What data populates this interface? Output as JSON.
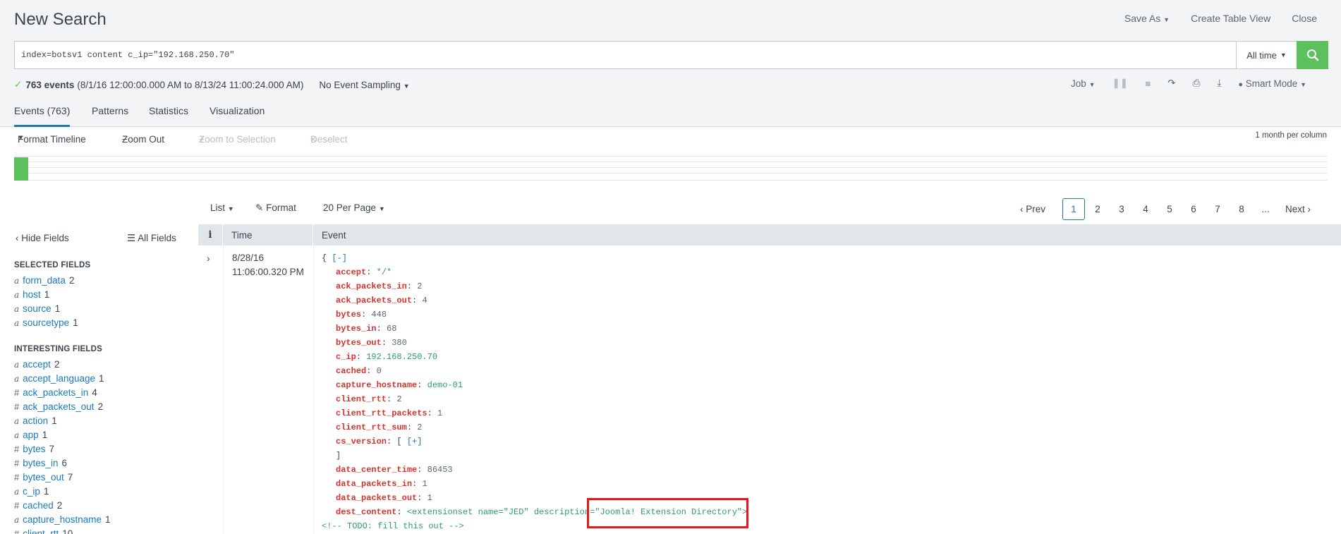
{
  "header": {
    "title": "New Search",
    "actions": [
      "Save As",
      "Create Table View",
      "Close"
    ]
  },
  "search": {
    "query": "index=botsv1 content c_ip=\"192.168.250.70\"",
    "time_range": "All time"
  },
  "status": {
    "count": "763 events",
    "range": "(8/1/16 12:00:00.000 AM to 8/13/24 11:00:24.000 AM)",
    "sampling": "No Event Sampling",
    "job": "Job",
    "mode": "Smart Mode"
  },
  "tabs": [
    "Events (763)",
    "Patterns",
    "Statistics",
    "Visualization"
  ],
  "timeline": {
    "format": "Format Timeline",
    "zoom_out": "Zoom Out",
    "zoom_selection": "Zoom to Selection",
    "deselect": "Deselect",
    "per_column": "1 month per column"
  },
  "list_controls": {
    "list": "List",
    "format": "Format",
    "per_page": "20 Per Page"
  },
  "pager": {
    "prev": "Prev",
    "pages": [
      "1",
      "2",
      "3",
      "4",
      "5",
      "6",
      "7",
      "8"
    ],
    "ellipsis": "...",
    "next": "Next",
    "current": "1"
  },
  "sidebar": {
    "hide_fields": "Hide Fields",
    "all_fields": "All Fields",
    "selected_heading": "SELECTED FIELDS",
    "selected": [
      {
        "type": "a",
        "name": "form_data",
        "count": "2"
      },
      {
        "type": "a",
        "name": "host",
        "count": "1"
      },
      {
        "type": "a",
        "name": "source",
        "count": "1"
      },
      {
        "type": "a",
        "name": "sourcetype",
        "count": "1"
      }
    ],
    "interesting_heading": "INTERESTING FIELDS",
    "interesting": [
      {
        "type": "a",
        "name": "accept",
        "count": "2"
      },
      {
        "type": "a",
        "name": "accept_language",
        "count": "1"
      },
      {
        "type": "#",
        "name": "ack_packets_in",
        "count": "4"
      },
      {
        "type": "#",
        "name": "ack_packets_out",
        "count": "2"
      },
      {
        "type": "a",
        "name": "action",
        "count": "1"
      },
      {
        "type": "a",
        "name": "app",
        "count": "1"
      },
      {
        "type": "#",
        "name": "bytes",
        "count": "7"
      },
      {
        "type": "#",
        "name": "bytes_in",
        "count": "6"
      },
      {
        "type": "#",
        "name": "bytes_out",
        "count": "7"
      },
      {
        "type": "a",
        "name": "c_ip",
        "count": "1"
      },
      {
        "type": "#",
        "name": "cached",
        "count": "2"
      },
      {
        "type": "a",
        "name": "capture_hostname",
        "count": "1"
      },
      {
        "type": "#",
        "name": "client_rtt",
        "count": "10"
      }
    ]
  },
  "table": {
    "col_info": "i",
    "col_time": "Time",
    "col_event": "Event"
  },
  "event": {
    "date": "8/28/16",
    "time": "11:06:00.320 PM",
    "open_brace": "{",
    "collapse": "[-]",
    "fields": [
      {
        "key": "accept",
        "value": "*/*",
        "kind": "str"
      },
      {
        "key": "ack_packets_in",
        "value": "2",
        "kind": "num"
      },
      {
        "key": "ack_packets_out",
        "value": "4",
        "kind": "num"
      },
      {
        "key": "bytes",
        "value": "448",
        "kind": "num"
      },
      {
        "key": "bytes_in",
        "value": "68",
        "kind": "num"
      },
      {
        "key": "bytes_out",
        "value": "380",
        "kind": "num"
      },
      {
        "key": "c_ip",
        "value": "192.168.250.70",
        "kind": "str"
      },
      {
        "key": "cached",
        "value": "0",
        "kind": "num"
      },
      {
        "key": "capture_hostname",
        "value": "demo-01",
        "kind": "str"
      },
      {
        "key": "client_rtt",
        "value": "2",
        "kind": "num"
      },
      {
        "key": "client_rtt_packets",
        "value": "1",
        "kind": "num"
      },
      {
        "key": "client_rtt_sum",
        "value": "2",
        "kind": "num"
      }
    ],
    "cs_version_key": "cs_version",
    "cs_version_open": "[",
    "cs_version_expand": "[+]",
    "cs_version_close": "]",
    "fields2": [
      {
        "key": "data_center_time",
        "value": "86453",
        "kind": "num"
      },
      {
        "key": "data_packets_in",
        "value": "1",
        "kind": "num"
      },
      {
        "key": "data_packets_out",
        "value": "1",
        "kind": "num"
      }
    ],
    "dest_content_key": "dest_content",
    "dest_content_value": "<extensionset name=\"JED\" description=\"Joomla! Extension Directory\">",
    "comment": "<!-- TODO: fill this out -->"
  },
  "colors": {
    "accent": "#1a79bf",
    "success": "#5cc05c",
    "field_key": "#d5322c",
    "highlight": "#e0191b"
  }
}
